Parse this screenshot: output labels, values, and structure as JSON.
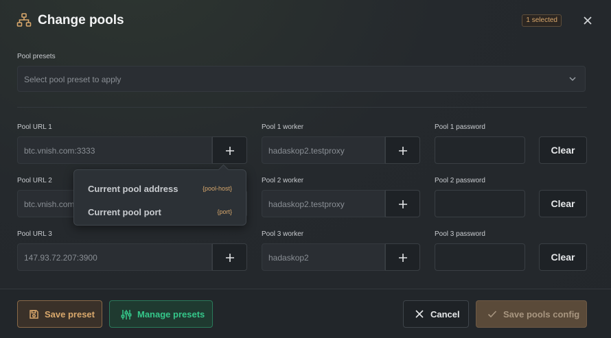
{
  "header": {
    "title": "Change pools",
    "badge": "1 selected"
  },
  "presets": {
    "label": "Pool presets",
    "placeholder": "Select pool preset to apply"
  },
  "pools": [
    {
      "url_label": "Pool URL 1",
      "url_value": "btc.vnish.com:3333",
      "worker_label": "Pool 1 worker",
      "worker_value": "hadaskop2.testproxy",
      "password_label": "Pool 1 password",
      "password_value": "",
      "clear_label": "Clear"
    },
    {
      "url_label": "Pool URL 2",
      "url_value": "btc.vnish.com",
      "worker_label": "Pool 2 worker",
      "worker_value": "hadaskop2.testproxy",
      "password_label": "Pool 2 password",
      "password_value": "",
      "clear_label": "Clear"
    },
    {
      "url_label": "Pool URL 3",
      "url_value": "147.93.72.207:3900",
      "worker_label": "Pool 3 worker",
      "worker_value": "hadaskop2",
      "password_label": "Pool 3 password",
      "password_value": "",
      "clear_label": "Clear"
    }
  ],
  "dropdown": {
    "items": [
      {
        "label": "Current pool address",
        "tag": "{pool-host}"
      },
      {
        "label": "Current pool port",
        "tag": "{port}"
      }
    ]
  },
  "footer": {
    "save_preset": "Save preset",
    "manage_presets": "Manage presets",
    "cancel": "Cancel",
    "save_config": "Save pools config"
  },
  "colors": {
    "accent": "#d9a86c",
    "green": "#35c78a",
    "background": "#23272b"
  },
  "icons": {
    "title": "sitemap-icon",
    "close": "close-icon",
    "chevron": "chevron-down-icon",
    "plus": "plus-icon",
    "save": "save-icon",
    "manage": "sliders-icon",
    "cancel": "x-icon",
    "confirm": "check-icon"
  }
}
